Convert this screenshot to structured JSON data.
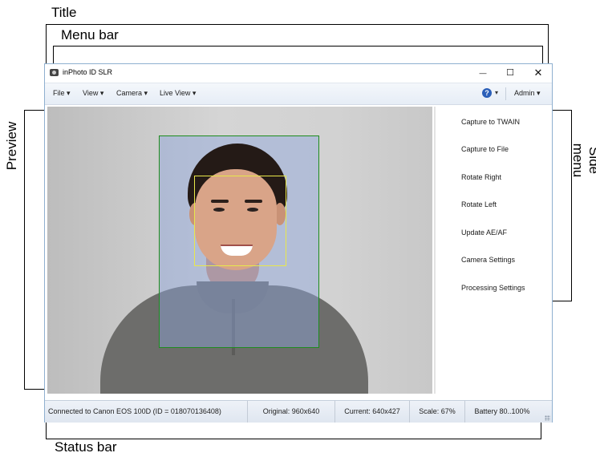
{
  "annotations": {
    "title": "Title",
    "menu_bar": "Menu bar",
    "preview": "Preview",
    "side_menu": "Side menu",
    "status_bar": "Status bar"
  },
  "window": {
    "title": "inPhoto ID SLR",
    "controls": {
      "minimize": "—",
      "maximize": "☐",
      "close": "✕"
    }
  },
  "menubar": {
    "items": [
      "File ▾",
      "View ▾",
      "Camera ▾",
      "Live View ▾"
    ],
    "help_icon": "?",
    "help_caret": "▾",
    "admin": "Admin ▾"
  },
  "side_menu": {
    "items": [
      "Capture to TWAIN",
      "Capture to File",
      "Rotate Right",
      "Rotate Left",
      "Update AE/AF",
      "Camera Settings",
      "Processing Settings"
    ]
  },
  "status_bar": {
    "connection": "Connected to Canon EOS 100D (ID = 018070136408)",
    "original": "Original: 960x640",
    "current": "Current: 640x427",
    "scale": "Scale: 67%",
    "battery": "Battery 80..100%"
  },
  "colors": {
    "face_frame": "#1e8c1e",
    "head_frame": "#e8e84a",
    "help_icon": "#2b5fb8"
  }
}
